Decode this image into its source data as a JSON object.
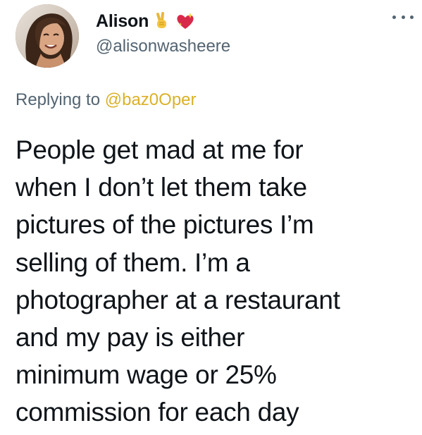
{
  "tweet": {
    "author": {
      "name": "Alison",
      "handle": "@alisonwasheere",
      "name_emojis": [
        "victory-hand-icon",
        "sparkling-heart-icon"
      ]
    },
    "replying_prefix": "Replying to",
    "replying_mention": "@baz0Oper",
    "text_lines": [
      "People get mad at me for",
      "when I don’t let them take",
      "pictures of the pictures I’m",
      "selling of them. I’m a",
      "photographer at a restaurant",
      "and my pay is either",
      "minimum wage or 25%",
      "commission for each day"
    ],
    "colors": {
      "mention": "#d9b12a",
      "secondary_text": "#536471",
      "primary_text": "#0f1419",
      "heart": "#d8294a"
    },
    "more_icon": "more-options-icon"
  }
}
